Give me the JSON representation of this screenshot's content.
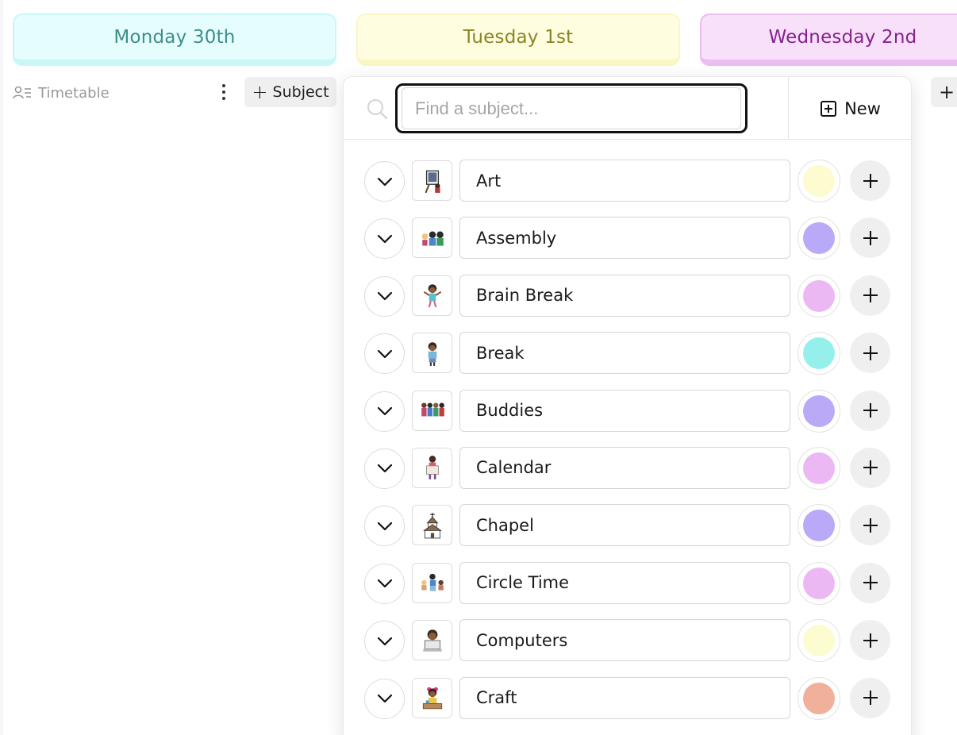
{
  "days": [
    {
      "label": "Monday 30th"
    },
    {
      "label": "Tuesday 1st"
    },
    {
      "label": "Wednesday 2nd"
    }
  ],
  "toolbar": {
    "timetable_label": "Timetable",
    "subject_button": "Subject",
    "peek_button": "+"
  },
  "popup": {
    "search_placeholder": "Find a subject...",
    "search_value": "",
    "new_button": "New",
    "subjects": [
      {
        "name": "Art",
        "color": "#fdfbd0",
        "thumb": "easel-painting-icon"
      },
      {
        "name": "Assembly",
        "color": "#b9a9f6",
        "thumb": "children-group-icon"
      },
      {
        "name": "Brain Break",
        "color": "#ebb8f4",
        "thumb": "girl-stretching-icon"
      },
      {
        "name": "Break",
        "color": "#95f0ec",
        "thumb": "boy-standing-icon"
      },
      {
        "name": "Buddies",
        "color": "#b9a9f6",
        "thumb": "kids-holding-hands-icon"
      },
      {
        "name": "Calendar",
        "color": "#ebb8f4",
        "thumb": "teacher-calendar-icon"
      },
      {
        "name": "Chapel",
        "color": "#b9a9f6",
        "thumb": "chapel-building-icon"
      },
      {
        "name": "Circle Time",
        "color": "#ebb8f4",
        "thumb": "children-circle-icon"
      },
      {
        "name": "Computers",
        "color": "#fdfbd0",
        "thumb": "child-computer-icon"
      },
      {
        "name": "Craft",
        "color": "#f0b09c",
        "thumb": "girl-crafting-icon"
      }
    ]
  }
}
